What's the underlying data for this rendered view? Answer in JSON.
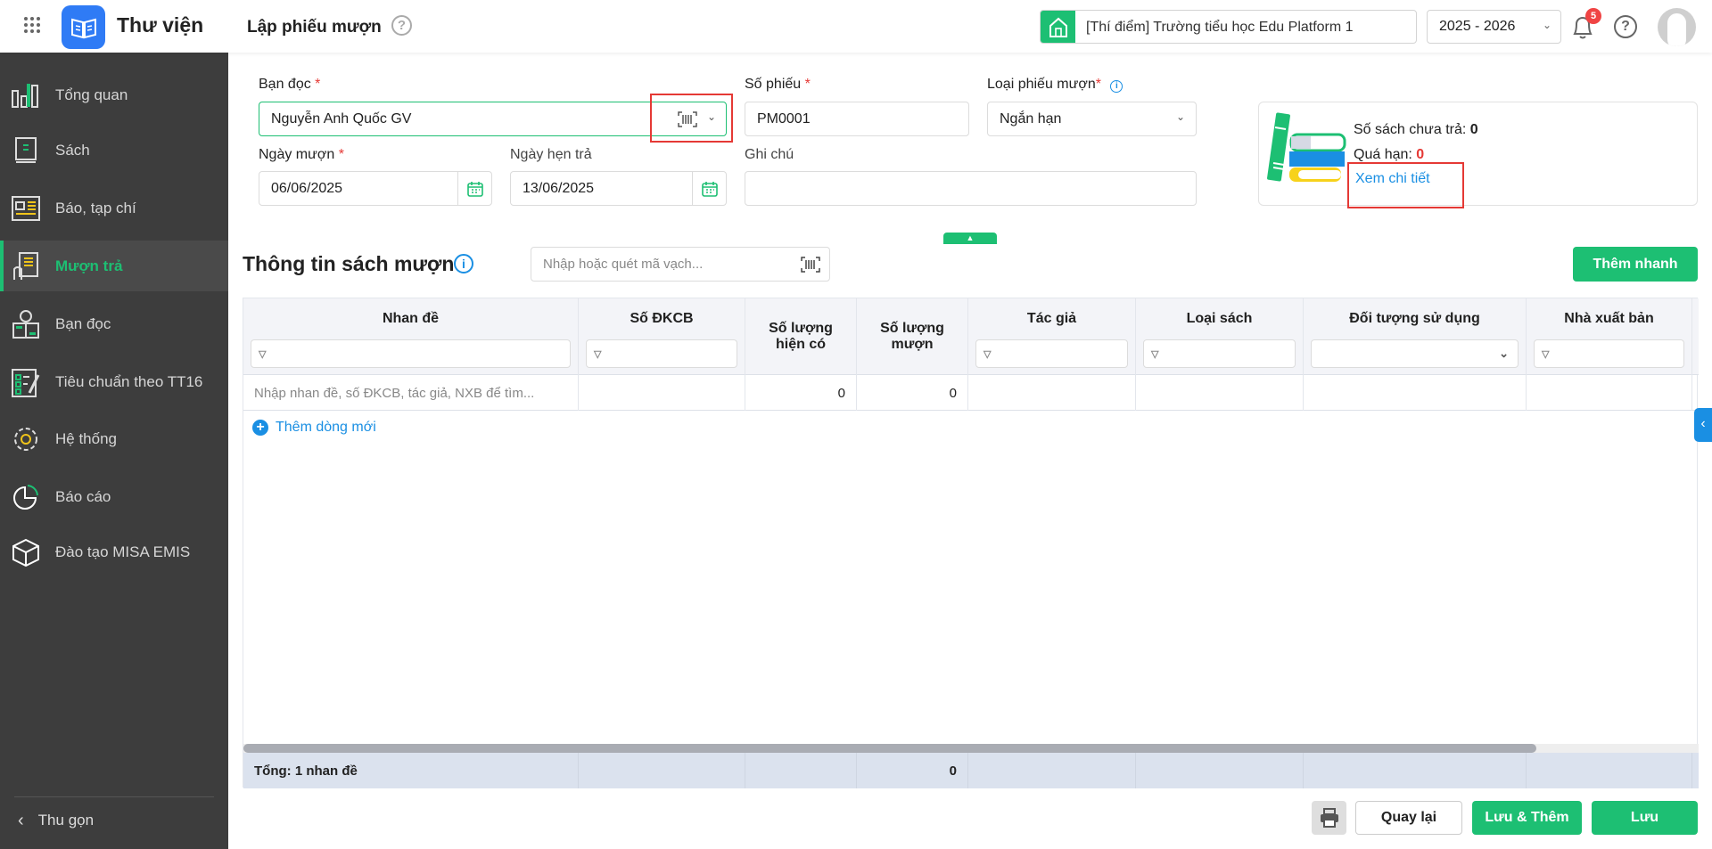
{
  "header": {
    "app_name": "Thư viện",
    "page_title": "Lập phiếu mượn",
    "school": "[Thí điểm] Trường tiểu học Edu Platform 1",
    "school_year": "2025 - 2026",
    "notification_count": "5"
  },
  "sidebar": {
    "items": [
      {
        "label": "Tổng quan",
        "icon": "chart-icon"
      },
      {
        "label": "Sách",
        "icon": "book-icon"
      },
      {
        "label": "Báo, tạp chí",
        "icon": "newspaper-icon"
      },
      {
        "label": "Mượn trả",
        "icon": "borrow-icon",
        "active": true
      },
      {
        "label": "Bạn đọc",
        "icon": "reader-icon"
      },
      {
        "label": "Tiêu chuẩn theo TT16",
        "icon": "checklist-icon"
      },
      {
        "label": "Hệ thống",
        "icon": "gear-icon"
      },
      {
        "label": "Báo cáo",
        "icon": "pie-icon"
      },
      {
        "label": "Đào tạo MISA EMIS",
        "icon": "cube-icon"
      }
    ],
    "collapse_label": "Thu gọn"
  },
  "form": {
    "reader_label": "Bạn đọc",
    "reader_value": "Nguyễn Anh Quốc GV",
    "slip_no_label": "Số phiếu",
    "slip_no_value": "PM0001",
    "slip_type_label": "Loại phiếu mượn",
    "slip_type_value": "Ngắn hạn",
    "borrow_date_label": "Ngày mượn",
    "borrow_date_value": "06/06/2025",
    "due_date_label": "Ngày hẹn trả",
    "due_date_value": "13/06/2025",
    "note_label": "Ghi chú",
    "note_value": "",
    "required_mark": "*"
  },
  "summary": {
    "unreturned_label": "Số sách chưa trả:",
    "unreturned_value": "0",
    "overdue_label": "Quá hạn:",
    "overdue_value": "0",
    "details_link": "Xem chi tiết"
  },
  "books": {
    "title": "Thông tin sách mượn",
    "barcode_placeholder": "Nhập hoặc quét mã vạch...",
    "quick_add": "Thêm nhanh",
    "columns": [
      "Nhan đề",
      "Số ĐKCB",
      "Số lượng hiện có",
      "Số lượng mượn",
      "Tác giả",
      "Loại sách",
      "Đối tượng sử dụng",
      "Nhà xuất bản"
    ],
    "row": {
      "placeholder": "Nhập nhan đề, số ĐKCB, tác giả, NXB để tìm...",
      "available": "0",
      "borrowed": "0"
    },
    "add_row": "Thêm dòng mới",
    "footer": {
      "total": "Tổng: 1 nhan đề",
      "borrowed_total": "0"
    }
  },
  "actions": {
    "back": "Quay lại",
    "save_add": "Lưu & Thêm",
    "save": "Lưu"
  },
  "colors": {
    "accent": "#1dbf73",
    "link": "#1a8fe3",
    "sidebar": "#3d3d3d",
    "highlight_box": "#e53935"
  }
}
